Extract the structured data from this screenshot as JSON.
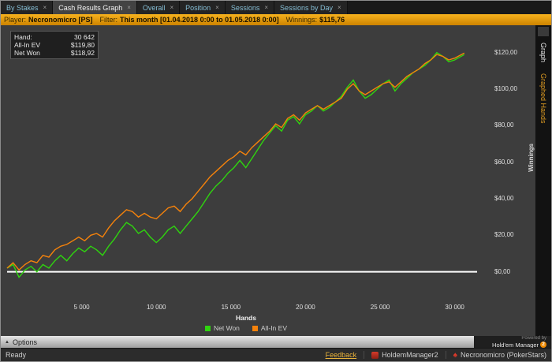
{
  "icons": {
    "close": "×",
    "options_arrow": "▲",
    "spade": "♠"
  },
  "colors": {
    "net_won": "#2fd40f",
    "all_in_ev": "#f5820b",
    "zero_line": "#ffffff",
    "accent_orange": "#e8a000"
  },
  "tabs": [
    {
      "label": "By Stakes",
      "active": false
    },
    {
      "label": "Cash Results Graph",
      "active": true
    },
    {
      "label": "Overall",
      "active": false
    },
    {
      "label": "Position",
      "active": false
    },
    {
      "label": "Sessions",
      "active": false
    },
    {
      "label": "Sessions by Day",
      "active": false
    }
  ],
  "filter_bar": {
    "player_label": "Player:",
    "player_value": "Necronomicro [PS]",
    "filter_label": "Filter:",
    "filter_value": "This month [01.04.2018 0:00 to 01.05.2018 0:00]",
    "winnings_label": "Winnings:",
    "winnings_value": "$115,76"
  },
  "info_box": {
    "hand_label": "Hand:",
    "hand_value": "30 642",
    "allin_ev_label": "All-In EV",
    "allin_ev_value": "$119,80",
    "net_won_label": "Net Won",
    "net_won_value": "$118,92"
  },
  "chart_data": {
    "type": "line",
    "title": "",
    "xlabel": "Hands",
    "ylabel": "Winnings",
    "xlim": [
      0,
      31500
    ],
    "ylim": [
      -17,
      135
    ],
    "grid": false,
    "zero_line": true,
    "legend_position": "bottom",
    "x_ticks": {
      "values": [
        5000,
        10000,
        15000,
        20000,
        25000,
        30000
      ],
      "labels": [
        "5 000",
        "10 000",
        "15 000",
        "20 000",
        "25 000",
        "30 000"
      ]
    },
    "y_ticks": {
      "values": [
        120,
        100,
        80,
        60,
        40,
        20,
        0
      ],
      "labels": [
        "$120,00",
        "$100,00",
        "$80,00",
        "$60,00",
        "$40,00",
        "$20,00",
        "$0,00"
      ]
    },
    "x": [
      0,
      400,
      800,
      1200,
      1600,
      2000,
      2400,
      2800,
      3200,
      3600,
      4000,
      4400,
      4800,
      5200,
      5600,
      6000,
      6400,
      6800,
      7200,
      7600,
      8000,
      8400,
      8800,
      9200,
      9600,
      10000,
      10400,
      10800,
      11200,
      11600,
      12000,
      12400,
      12800,
      13200,
      13600,
      14000,
      14400,
      14800,
      15200,
      15600,
      16000,
      16400,
      16800,
      17200,
      17600,
      18000,
      18400,
      18800,
      19200,
      19600,
      20000,
      20400,
      20800,
      21200,
      21600,
      22000,
      22400,
      22800,
      23200,
      23600,
      24000,
      24400,
      24800,
      25200,
      25600,
      26000,
      26400,
      26800,
      27200,
      27600,
      28000,
      28400,
      28800,
      29200,
      29600,
      30000,
      30642
    ],
    "series": [
      {
        "name": "Net Won",
        "color": "#2fd40f",
        "y": [
          2,
          4,
          -3,
          1,
          3,
          0,
          4,
          2,
          6,
          9,
          6,
          10,
          13,
          11,
          14,
          12,
          9,
          14,
          18,
          23,
          27,
          25,
          21,
          23,
          19,
          16,
          19,
          23,
          25,
          21,
          25,
          29,
          33,
          38,
          43,
          47,
          50,
          54,
          57,
          61,
          57,
          62,
          67,
          72,
          76,
          80,
          77,
          83,
          85,
          81,
          86,
          88,
          91,
          88,
          90,
          93,
          96,
          101,
          105,
          99,
          95,
          97,
          100,
          103,
          105,
          99,
          103,
          106,
          109,
          111,
          113,
          116,
          120,
          118,
          115,
          116,
          118.92
        ]
      },
      {
        "name": "All-In EV",
        "color": "#f5820b",
        "y": [
          2,
          5,
          1,
          4,
          6,
          5,
          9,
          8,
          12,
          14,
          15,
          17,
          19,
          17,
          20,
          21,
          19,
          24,
          28,
          31,
          34,
          33,
          30,
          32,
          30,
          29,
          32,
          35,
          36,
          33,
          37,
          40,
          44,
          48,
          52,
          55,
          58,
          61,
          63,
          66,
          64,
          68,
          71,
          74,
          77,
          81,
          79,
          84,
          86,
          83,
          87,
          89,
          91,
          89,
          91,
          93,
          95,
          100,
          103,
          99,
          97,
          99,
          101,
          103,
          104,
          101,
          104,
          107,
          109,
          111,
          114,
          116,
          119,
          118,
          116,
          117,
          119.8
        ]
      }
    ]
  },
  "side_tabs": {
    "items": [
      {
        "label": "Graph",
        "active": true
      },
      {
        "label": "Graphed Hands",
        "active": false
      }
    ]
  },
  "options_bar": {
    "label": "Options"
  },
  "branding": {
    "powered_by": "Powered by",
    "name": "Hold'em Manager",
    "badge": "2"
  },
  "status_bar": {
    "ready": "Ready",
    "feedback": "Feedback",
    "app": "HoldemManager2",
    "account": "Necronomicro (PokerStars)"
  }
}
